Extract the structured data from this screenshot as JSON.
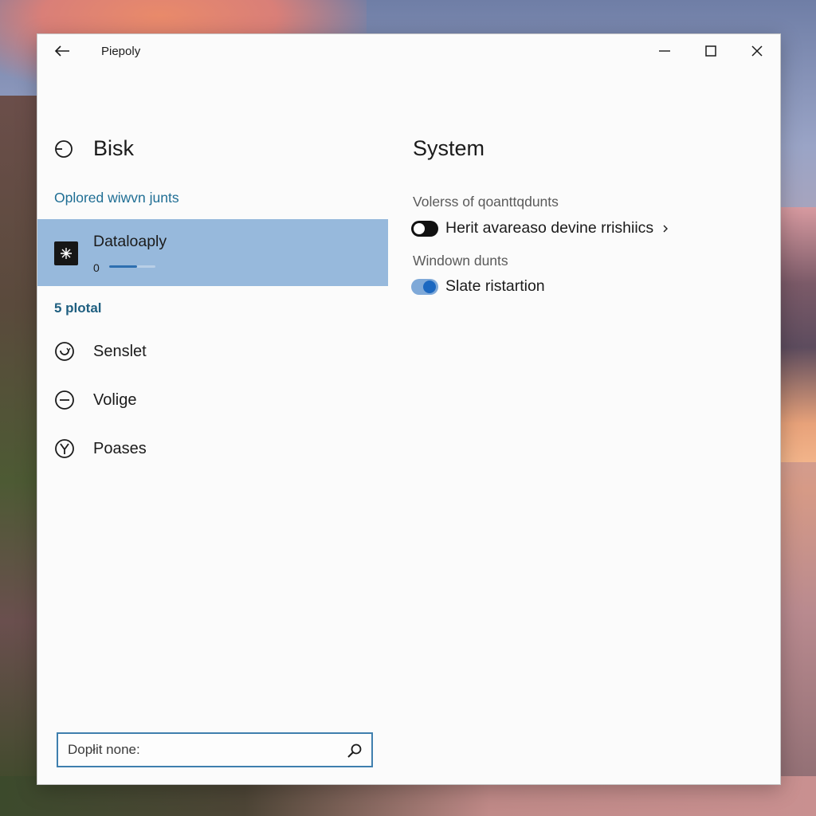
{
  "window": {
    "title": "Piepoly"
  },
  "left_pane": {
    "header": "Bisk",
    "section_label": "Oplored wiwvn junts",
    "selected_item": {
      "label": "Dataloaply",
      "count": "0",
      "progress": 0.6
    },
    "section_label_2": "5 plotal",
    "nav_items": [
      {
        "label": "Senslet",
        "icon": "refresh-circle-icon"
      },
      {
        "label": "Volige",
        "icon": "minus-circle-icon"
      },
      {
        "label": "Poases",
        "icon": "y-circle-icon"
      }
    ],
    "search": {
      "placeholder": "Dopłit none:"
    }
  },
  "right_pane": {
    "title": "System",
    "groups": [
      {
        "label": "Volerss of qoanttqdunts",
        "setting": {
          "label": "Herit avareaso devine rrishiics",
          "state": "off",
          "has_chevron": true
        }
      },
      {
        "label": "Windown dunts",
        "setting": {
          "label": "Slate ristartion",
          "state": "on",
          "has_chevron": false
        }
      }
    ]
  },
  "colors": {
    "accent": "#1c68c0",
    "selection": "#97b9dc",
    "section_label": "#1f6e94",
    "search_border": "#3f7fae"
  }
}
